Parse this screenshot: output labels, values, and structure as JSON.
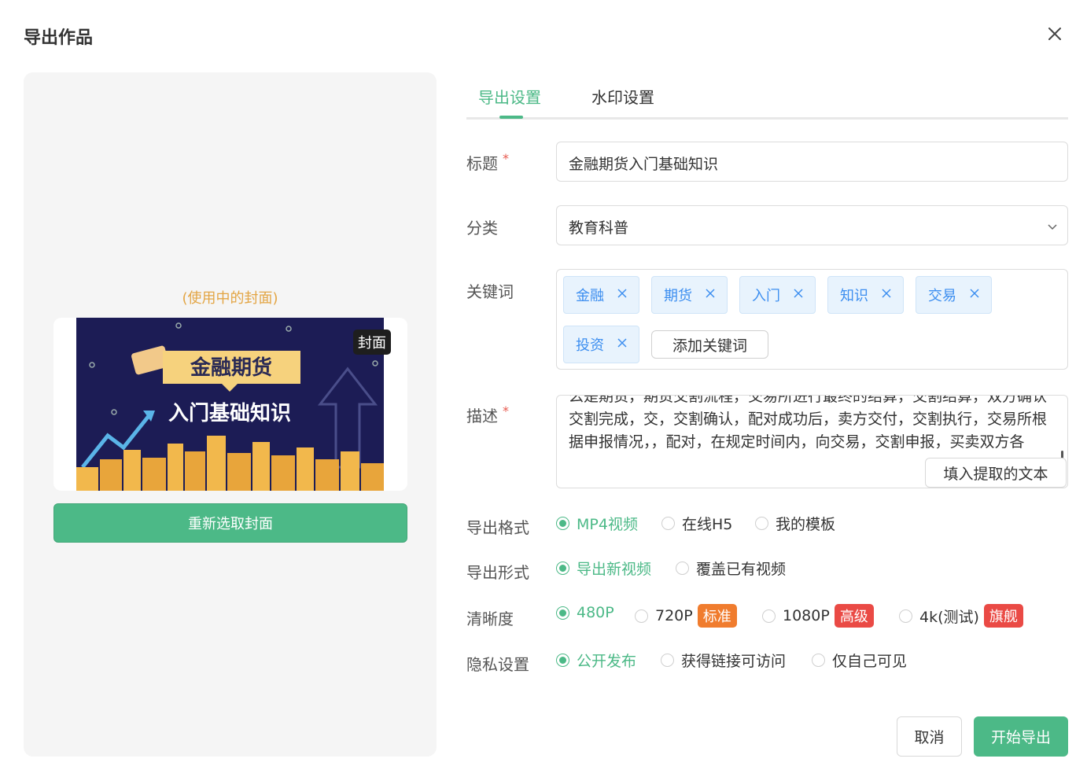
{
  "dialog": {
    "title": "导出作品"
  },
  "cover": {
    "tip": "(使用中的封面)",
    "badge": "封面",
    "image_title": "金融期货",
    "image_subtitle": "入门基础知识",
    "reselect_label": "重新选取封面"
  },
  "tabs": [
    {
      "label": "导出设置",
      "active": true
    },
    {
      "label": "水印设置",
      "active": false
    }
  ],
  "form": {
    "title": {
      "label": "标题",
      "required": "*",
      "value": "金融期货入门基础知识"
    },
    "category": {
      "label": "分类",
      "value": "教育科普"
    },
    "keywords": {
      "label": "关键词",
      "tags": [
        "金融",
        "期货",
        "入门",
        "知识",
        "交易",
        "投资"
      ],
      "add_label": "添加关键词"
    },
    "description": {
      "label": "描述",
      "required": "*",
      "value": "么是期货，期货交割流程，交易所进行最终的结算，交割结算，双方确认交割完成，交，交割确认，配对成功后，卖方交付，交割执行，交易所根据申报情况，，配对，在规定时间内，向交易，交割申报，买卖双方各",
      "fill_label": "填入提取的文本"
    },
    "format": {
      "label": "导出格式",
      "options": [
        "MP4视频",
        "在线H5",
        "我的模板"
      ],
      "selected": "MP4视频"
    },
    "mode": {
      "label": "导出形式",
      "options": [
        "导出新视频",
        "覆盖已有视频"
      ],
      "selected": "导出新视频"
    },
    "resolution": {
      "label": "清晰度",
      "options": [
        {
          "label": "480P",
          "tier": ""
        },
        {
          "label": "720P",
          "tier": "标准"
        },
        {
          "label": "1080P",
          "tier": "高级"
        },
        {
          "label": "4k(测试)",
          "tier": "旗舰"
        }
      ],
      "selected": "480P"
    },
    "privacy": {
      "label": "隐私设置",
      "options": [
        "公开发布",
        "获得链接可访问",
        "仅自己可见"
      ],
      "selected": "公开发布"
    }
  },
  "footer": {
    "cancel_label": "取消",
    "export_label": "开始导出"
  },
  "colors": {
    "accent": "#4cb987",
    "tip": "#e3a544",
    "tier_standard": "#f07c2e",
    "tier_pro": "#ea4a45",
    "tag_text": "#3c8ef0"
  }
}
